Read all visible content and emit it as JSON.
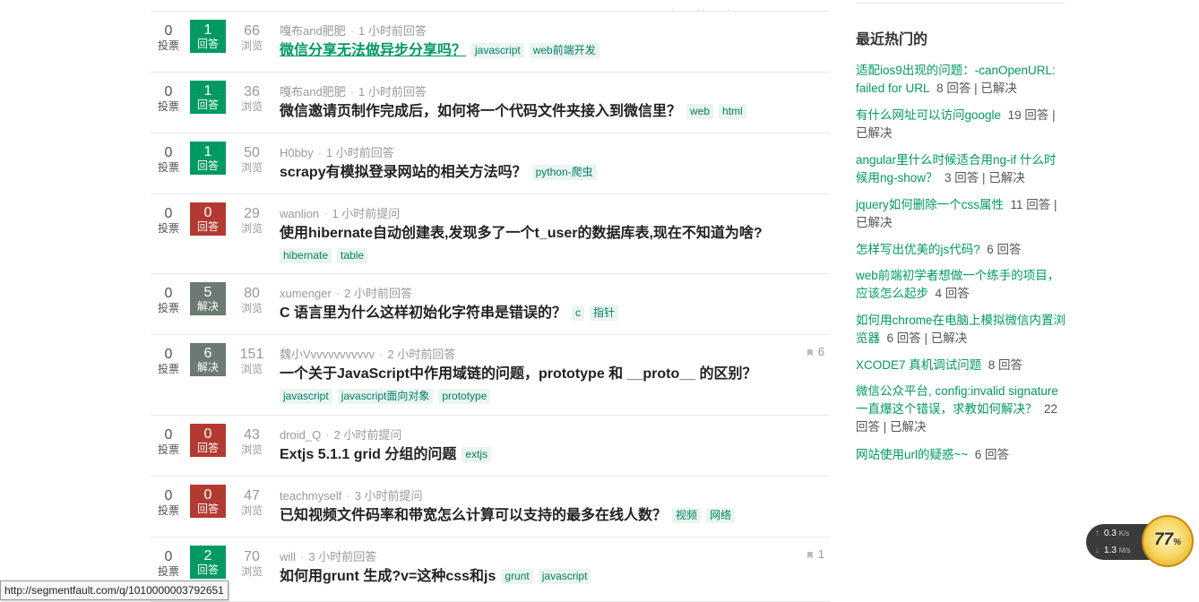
{
  "questions": [
    {
      "votes": "0",
      "votes_label": "投票",
      "answers": "1",
      "answers_label": "回答",
      "answers_state": "green",
      "views": "66",
      "views_label": "浏览",
      "author": "嘎布and肥肥",
      "time": "1 小时前回答",
      "title": "微信分享无法做异步分享吗？",
      "title_link": true,
      "tags": [
        "javascript",
        "web前端开发"
      ]
    },
    {
      "votes": "0",
      "votes_label": "投票",
      "answers": "1",
      "answers_label": "回答",
      "answers_state": "green",
      "views": "36",
      "views_label": "浏览",
      "author": "嘎布and肥肥",
      "time": "1 小时前回答",
      "title": "微信邀请页制作完成后，如何将一个代码文件夹接入到微信里？",
      "tags": [
        "web",
        "html"
      ]
    },
    {
      "votes": "0",
      "votes_label": "投票",
      "answers": "1",
      "answers_label": "回答",
      "answers_state": "green",
      "views": "50",
      "views_label": "浏览",
      "author": "H0bby",
      "time": "1 小时前回答",
      "title": "scrapy有模拟登录网站的相关方法吗？",
      "tags": [
        "python-爬虫"
      ]
    },
    {
      "votes": "0",
      "votes_label": "投票",
      "answers": "0",
      "answers_label": "回答",
      "answers_state": "red",
      "views": "29",
      "views_label": "浏览",
      "author": "wanlion",
      "time": "1 小时前提问",
      "title": "使用hibernate自动创建表,发现多了一个t_user的数据库表,现在不知道为啥?",
      "tags": [
        "hibernate",
        "table"
      ]
    },
    {
      "votes": "0",
      "votes_label": "投票",
      "answers": "5",
      "answers_label": "解决",
      "answers_state": "gray",
      "views": "80",
      "views_label": "浏览",
      "author": "xumenger",
      "time": "2 小时前回答",
      "title": "C 语言里为什么这样初始化字符串是错误的？",
      "tags": [
        "c",
        "指针"
      ]
    },
    {
      "votes": "0",
      "votes_label": "投票",
      "answers": "6",
      "answers_label": "解决",
      "answers_state": "gray",
      "views": "151",
      "views_label": "浏览",
      "author": "魏小Vvvvvvvvvvvv",
      "time": "2 小时前回答",
      "title": "一个关于JavaScript中作用域链的问题，prototype 和 __proto__ 的区别？",
      "tags": [
        "javascript",
        "javascript面向对象",
        "prototype"
      ],
      "bookmarks": "6"
    },
    {
      "votes": "0",
      "votes_label": "投票",
      "answers": "0",
      "answers_label": "回答",
      "answers_state": "red",
      "views": "43",
      "views_label": "浏览",
      "author": "droid_Q",
      "time": "2 小时前提问",
      "title": "Extjs 5.1.1 grid 分组的问题",
      "tags": [
        "extjs"
      ]
    },
    {
      "votes": "0",
      "votes_label": "投票",
      "answers": "0",
      "answers_label": "回答",
      "answers_state": "red",
      "views": "47",
      "views_label": "浏览",
      "author": "teachmyself",
      "time": "3 小时前提问",
      "title": "已知视频文件码率和带宽怎么计算可以支持的最多在线人数？",
      "tags": [
        "视频",
        "网络"
      ]
    },
    {
      "votes": "0",
      "votes_label": "投票",
      "answers": "2",
      "answers_label": "回答",
      "answers_state": "green",
      "views": "70",
      "views_label": "浏览",
      "author": "will",
      "time": "3 小时前回答",
      "title": "如何用grunt 生成?v=这种css和js",
      "tags": [
        "grunt",
        "javascript"
      ],
      "bookmarks": "1"
    }
  ],
  "sidebar": {
    "title": "最近热门的",
    "items": [
      {
        "q": "适配ios9出现的问题：-canOpenURL: failed for URL",
        "info": "8 回答 | 已解决"
      },
      {
        "q": "有什么网址可以访问google",
        "info": "19 回答 | 已解决"
      },
      {
        "q": "angular里什么时候适合用ng-if 什么时候用ng-show？",
        "info": "3 回答 | 已解决"
      },
      {
        "q": "jquery如何删除一个css属性",
        "info": "11 回答 | 已解决"
      },
      {
        "q": "怎样写出优美的js代码?",
        "info": "6 回答"
      },
      {
        "q": "web前端初学者想做一个练手的项目，应该怎么起步",
        "info": "4 回答"
      },
      {
        "q": "如何用chrome在电脑上模拟微信内置浏览器",
        "info": "6 回答 | 已解决"
      },
      {
        "q": "XCODE7 真机调试问题",
        "info": "8 回答"
      },
      {
        "q": "微信公众平台, config:invalid signature一直爆这个错误，求教如何解决？",
        "info": "22 回答 | 已解决"
      },
      {
        "q": "网站使用url的疑惑~~",
        "info": "6 回答"
      }
    ]
  },
  "statusbar": {
    "url": "http://segmentfault.com/q/1010000003792651"
  },
  "net_widget": {
    "upload": "0.3",
    "upload_unit": "K/s",
    "download": "1.3",
    "download_unit": "M/s",
    "percent": "77",
    "percent_sign": "%"
  },
  "colors": {
    "accent": "#009a61",
    "unanswered": "#b33a33",
    "solved": "#6c7a73"
  }
}
